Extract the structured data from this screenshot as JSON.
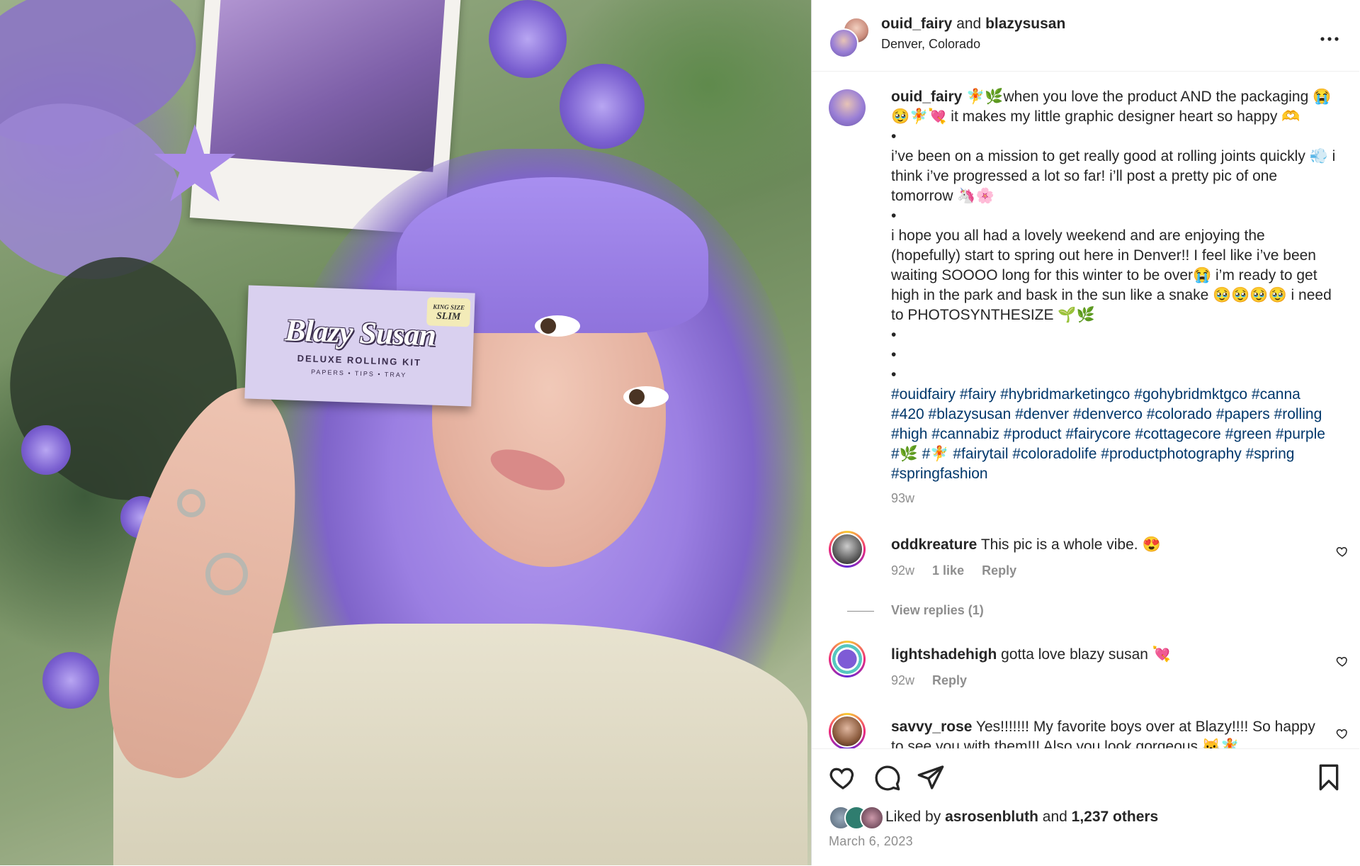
{
  "header": {
    "user1": "ouid_fairy",
    "and_text": "and",
    "user2": "blazysusan",
    "location": "Denver, Colorado",
    "more_icon": "more-horizontal-icon"
  },
  "photo": {
    "pack_badge_top": "KING SIZE",
    "pack_badge_bottom": "SLIM",
    "pack_logo": "Blazy Susan",
    "pack_subtitle": "DELUXE ROLLING KIT",
    "pack_subtitle2": "PAPERS • TIPS • TRAY"
  },
  "caption": {
    "user": "ouid_fairy",
    "lines": [
      "🧚🌿when you love the product AND the packaging 😭🥹🧚💘 it makes my little graphic designer heart so happy 🫶",
      "•",
      "i’ve been on a mission to get really good at rolling joints quickly 💨 i think i’ve progressed a lot so far! i’ll post a pretty pic of one tomorrow 🦄🌸",
      "•",
      "i hope you all had a lovely weekend and are enjoying the (hopefully) start to spring out here in Denver!! I feel like i’ve been waiting SOOOO long for this winter to be over😭 i’m ready to get high in the park and bask in the sun like a snake 🥹🥹🥹🥹 i need to PHOTOSYNTHESIZE 🌱🌿",
      "•",
      "•",
      "•"
    ],
    "hashtags": "#ouidfairy #fairy #hybridmarketingco #gohybridmktgco #canna #420 #blazysusan #denver #denverco #colorado #papers #rolling #high #cannabiz #product #fairycore #cottagecore #green #purple #🌿 #🧚 #fairytail #coloradolife #productphotography #spring #springfashion",
    "time": "93w"
  },
  "comments": [
    {
      "user": "oddkreature",
      "text": "This pic is a whole vibe. 😍",
      "time": "92w",
      "likes": "1 like",
      "reply": "Reply",
      "view_replies": "View replies (1)"
    },
    {
      "user": "lightshadehigh",
      "text": "gotta love blazy susan 💘",
      "time": "92w",
      "reply": "Reply"
    },
    {
      "user": "savvy_rose",
      "text": "Yes!!!!!!! My favorite boys over at Blazy!!!! So happy to see you with them!!! Also you look gorgeous 🐱🧚"
    }
  ],
  "actions": {
    "like_icon": "heart-icon",
    "comment_icon": "comment-icon",
    "share_icon": "share-icon",
    "save_icon": "bookmark-icon"
  },
  "likes": {
    "prefix": "Liked by",
    "user": "asrosenbluth",
    "and_text": "and",
    "others": "1,237 others"
  },
  "date": "March 6, 2023"
}
